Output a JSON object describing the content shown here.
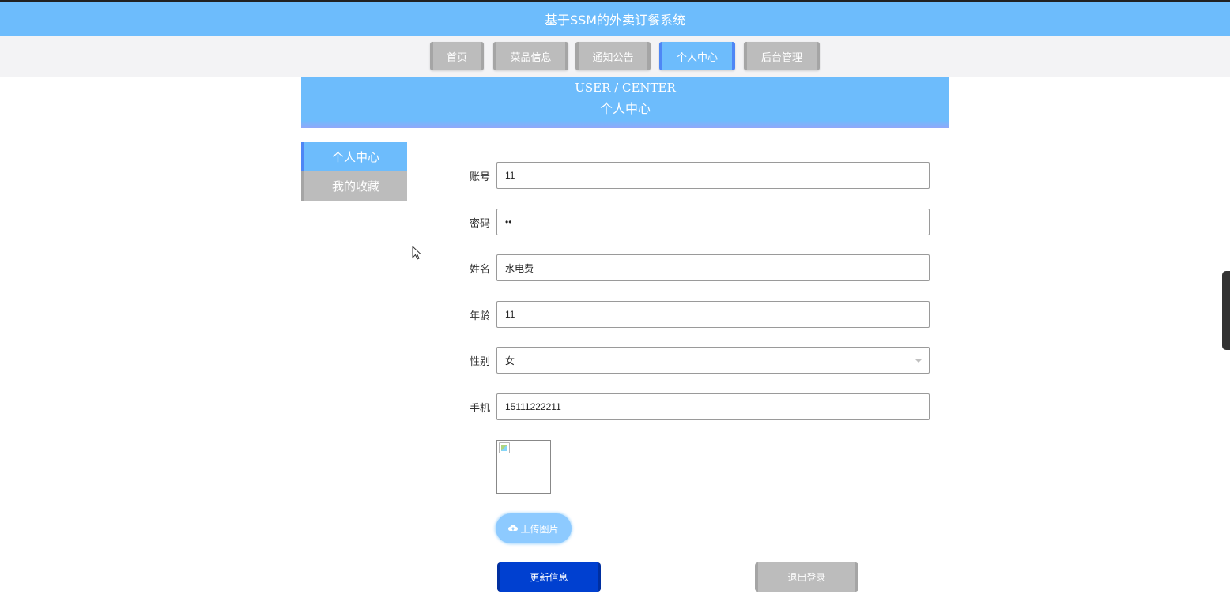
{
  "app": {
    "title": "基于SSM的外卖订餐系统"
  },
  "nav": {
    "items": [
      {
        "label": "首页",
        "active": false
      },
      {
        "label": "菜品信息",
        "active": false
      },
      {
        "label": "通知公告",
        "active": false
      },
      {
        "label": "个人中心",
        "active": true
      },
      {
        "label": "后台管理",
        "active": false
      }
    ]
  },
  "banner": {
    "en": "USER / CENTER",
    "cn": "个人中心"
  },
  "sidebar": {
    "items": [
      {
        "label": "个人中心",
        "active": true
      },
      {
        "label": "我的收藏",
        "active": false
      }
    ]
  },
  "form": {
    "account": {
      "label": "账号",
      "value": "11"
    },
    "password": {
      "label": "密码",
      "value": "11"
    },
    "name": {
      "label": "姓名",
      "value": "水电费"
    },
    "age": {
      "label": "年龄",
      "value": "11"
    },
    "gender": {
      "label": "性别",
      "value": "女"
    },
    "phone": {
      "label": "手机",
      "value": "15111222211"
    }
  },
  "buttons": {
    "upload": "上传图片",
    "update": "更新信息",
    "logout": "退出登录"
  },
  "colors": {
    "primary": "#6dbcfc",
    "active_border": "#4e86f5",
    "inactive": "#bcbcbc",
    "update_button": "#0040d0"
  }
}
